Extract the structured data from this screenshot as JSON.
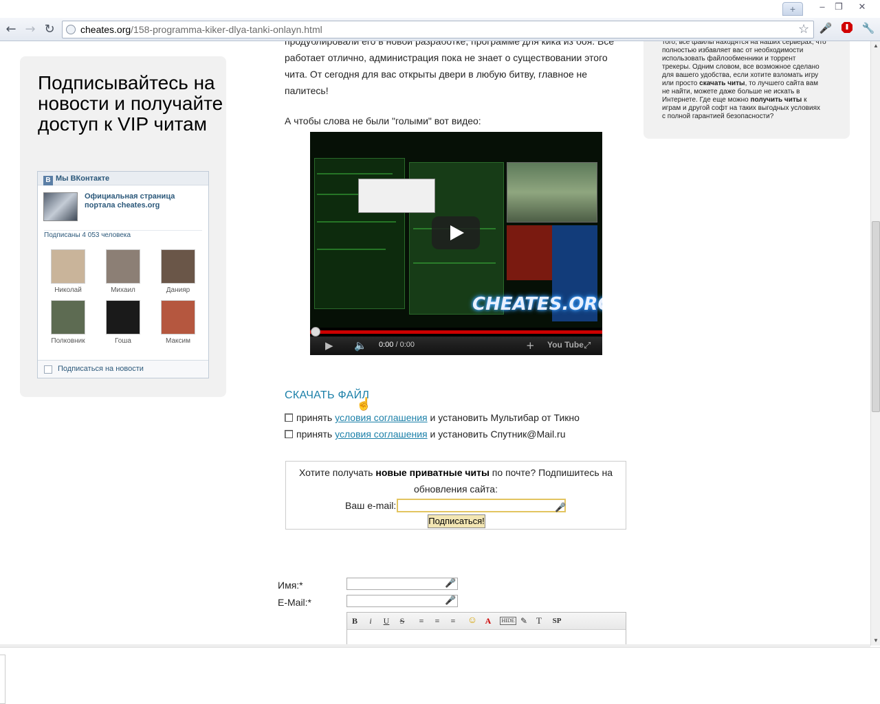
{
  "browser": {
    "new_tab_label": "+",
    "window_buttons": [
      "–",
      "❐",
      "✕"
    ],
    "url_host": "cheates.org",
    "url_path": "/158-programma-kiker-dlya-tanki-onlayn.html",
    "nav_icons": [
      "back-icon",
      "forward-icon",
      "reload-icon"
    ]
  },
  "left_sidebar": {
    "subscribe_title": "Подписывайтесь на новости и получайте доступ к VIP читам",
    "vk": {
      "header": "Мы ВКонтакте",
      "header_logo": "В",
      "page_link": "Официальная страница портала cheates.org",
      "subscribers": "Подписаны 4 053 человека",
      "members": [
        {
          "name": "Николай",
          "color": "#c9b49a"
        },
        {
          "name": "Михаил",
          "color": "#8c7f75"
        },
        {
          "name": "Данияр",
          "color": "#6a5648"
        },
        {
          "name": "Полковник",
          "color": "#5d6b52"
        },
        {
          "name": "Гоша",
          "color": "#1a1a1a"
        },
        {
          "name": "Максим",
          "color": "#b5573f"
        }
      ],
      "subscribe_checkbox": "Подписаться на новости"
    }
  },
  "article": {
    "paragraph_lines": [
      "продублировали его в новой разработке, программе для кика из боя. Все",
      "работает отлично, администрация пока не знает о существовании этого",
      "чита. От сегодня для вас открыты двери в любую битву, главное не",
      "палитесь!"
    ],
    "video_intro": "А чтобы слова не были \"голыми\" вот видео:",
    "video": {
      "watermark": "CHEATES.ORG",
      "time_current": "0:00",
      "time_total": " / 0:00",
      "youtube_label": "You Tube",
      "progress": 0
    },
    "download_label": "СКАЧАТЬ ФАЙЛ",
    "agreements": [
      {
        "prefix": "принять ",
        "link": "условия соглашения",
        "suffix": " и установить Мультибар от Тикно"
      },
      {
        "prefix": "принять ",
        "link": "условия соглашения",
        "suffix": " и установить Спутник@Mail.ru"
      }
    ],
    "subscribe_box": {
      "text_before": "Хотите получать ",
      "text_bold": "новые приватные читы",
      "text_after": " по почте? Подпишитесь на обновления сайта:",
      "email_label": "Ваш e-mail:",
      "email_value": "",
      "button": "Подписаться!"
    },
    "comment_form": {
      "name_label": "Имя:*",
      "email_label": "E-Mail:*",
      "toolbar": [
        "B",
        "i",
        "U",
        "S",
        "≡",
        "≡",
        "≡",
        "☺",
        "A",
        "HIDE",
        "✎",
        "T",
        "SP"
      ]
    }
  },
  "right_sidebar": {
    "lines": [
      {
        "t": "того, все файлы находятся на наших серверах, что"
      },
      {
        "t": "полностью избавляет вас от необходимости"
      },
      {
        "t": "использовать файлообменники и торрент"
      },
      {
        "t": "трекеры. Одним словом, все возможное сделано"
      },
      {
        "t": "для вашего удобства, если хотите взломать игру"
      },
      {
        "t": "или просто ",
        "b": "скачать читы",
        "a": ", то лучшего сайта вам"
      },
      {
        "t": "не найти, можете даже больше не искать в"
      },
      {
        "t": "Интернете. Где еще можно ",
        "b": "получить читы",
        "a": " к"
      },
      {
        "t": "играм и другой софт на таких выгодных условиях"
      },
      {
        "t": "с полной гарантией безопасности?"
      }
    ]
  }
}
